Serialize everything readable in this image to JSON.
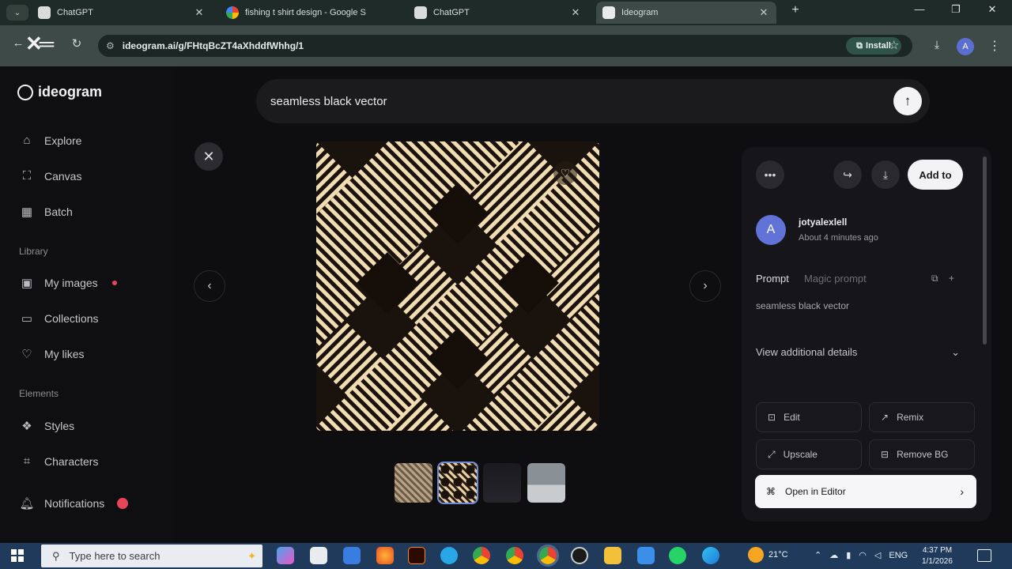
{
  "browser": {
    "tabs": [
      {
        "title": "ChatGPT",
        "active": false
      },
      {
        "title": "fishing t shirt design - Google S",
        "active": false
      },
      {
        "title": "ChatGPT",
        "active": false
      },
      {
        "title": "Ideogram",
        "active": true
      }
    ],
    "url": "ideogram.ai/g/FHtqBcZT4aXhddfWhhg/1",
    "install_label": "Install",
    "profile_initial": "A"
  },
  "sidebar": {
    "logo": "ideogram",
    "nav_top": [
      {
        "label": "Explore",
        "icon": "home-icon"
      },
      {
        "label": "Canvas",
        "icon": "canvas-icon"
      },
      {
        "label": "Batch",
        "icon": "batch-icon"
      }
    ],
    "library_label": "Library",
    "library": [
      {
        "label": "My images",
        "icon": "images-icon",
        "dot": true
      },
      {
        "label": "Collections",
        "icon": "folder-icon"
      },
      {
        "label": "My likes",
        "icon": "heart-icon"
      }
    ],
    "elements_label": "Elements",
    "elements": [
      {
        "label": "Styles",
        "icon": "styles-icon"
      },
      {
        "label": "Characters",
        "icon": "characters-icon"
      }
    ],
    "notifications_label": "Notifications"
  },
  "prompt_bar": {
    "text": "seamless black vector"
  },
  "panel": {
    "add_to_label": "Add to",
    "avatar_initial": "A",
    "username": "jotyalexlell",
    "timestamp": "About 4 minutes ago",
    "prompt_tab": "Prompt",
    "magic_tab": "Magic prompt",
    "prompt_text": "seamless black vector",
    "details_label": "View additional details",
    "actions": {
      "edit": "Edit",
      "remix": "Remix",
      "upscale": "Upscale",
      "remove_bg": "Remove BG"
    },
    "open_editor": "Open in Editor"
  },
  "taskbar": {
    "search_placeholder": "Type here to search",
    "temperature": "21°C",
    "lang": "ENG",
    "time": "4:37 PM",
    "date": "1/1/2026"
  },
  "colors": {
    "accent": "#6173d6",
    "pattern_light": "#f1dcb4",
    "pattern_dark": "#1a120c"
  }
}
